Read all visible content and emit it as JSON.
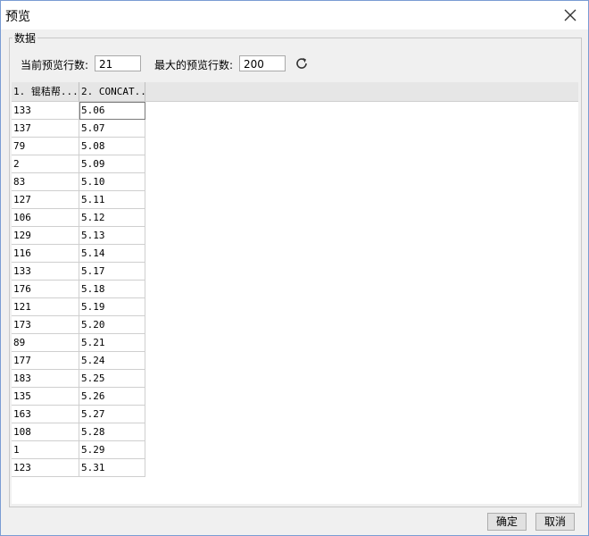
{
  "window": {
    "title": "预览"
  },
  "group": {
    "label": "数据"
  },
  "controls": {
    "current_label": "当前预览行数:",
    "current_value": "21",
    "max_label": "最大的预览行数:",
    "max_value": "200"
  },
  "table": {
    "columns": [
      "1. 锟秸帮...",
      "2. CONCAT..."
    ],
    "rows": [
      [
        "133",
        "5.06"
      ],
      [
        "137",
        "5.07"
      ],
      [
        "79",
        "5.08"
      ],
      [
        "2",
        "5.09"
      ],
      [
        "83",
        "5.10"
      ],
      [
        "127",
        "5.11"
      ],
      [
        "106",
        "5.12"
      ],
      [
        "129",
        "5.13"
      ],
      [
        "116",
        "5.14"
      ],
      [
        "133",
        "5.17"
      ],
      [
        "176",
        "5.18"
      ],
      [
        "121",
        "5.19"
      ],
      [
        "173",
        "5.20"
      ],
      [
        "89",
        "5.21"
      ],
      [
        "177",
        "5.24"
      ],
      [
        "183",
        "5.25"
      ],
      [
        "135",
        "5.26"
      ],
      [
        "163",
        "5.27"
      ],
      [
        "108",
        "5.28"
      ],
      [
        "1",
        "5.29"
      ],
      [
        "123",
        "5.31"
      ]
    ]
  },
  "buttons": {
    "ok": "确定",
    "cancel": "取消"
  },
  "icons": {
    "close": "close-icon",
    "refresh": "refresh-icon"
  }
}
